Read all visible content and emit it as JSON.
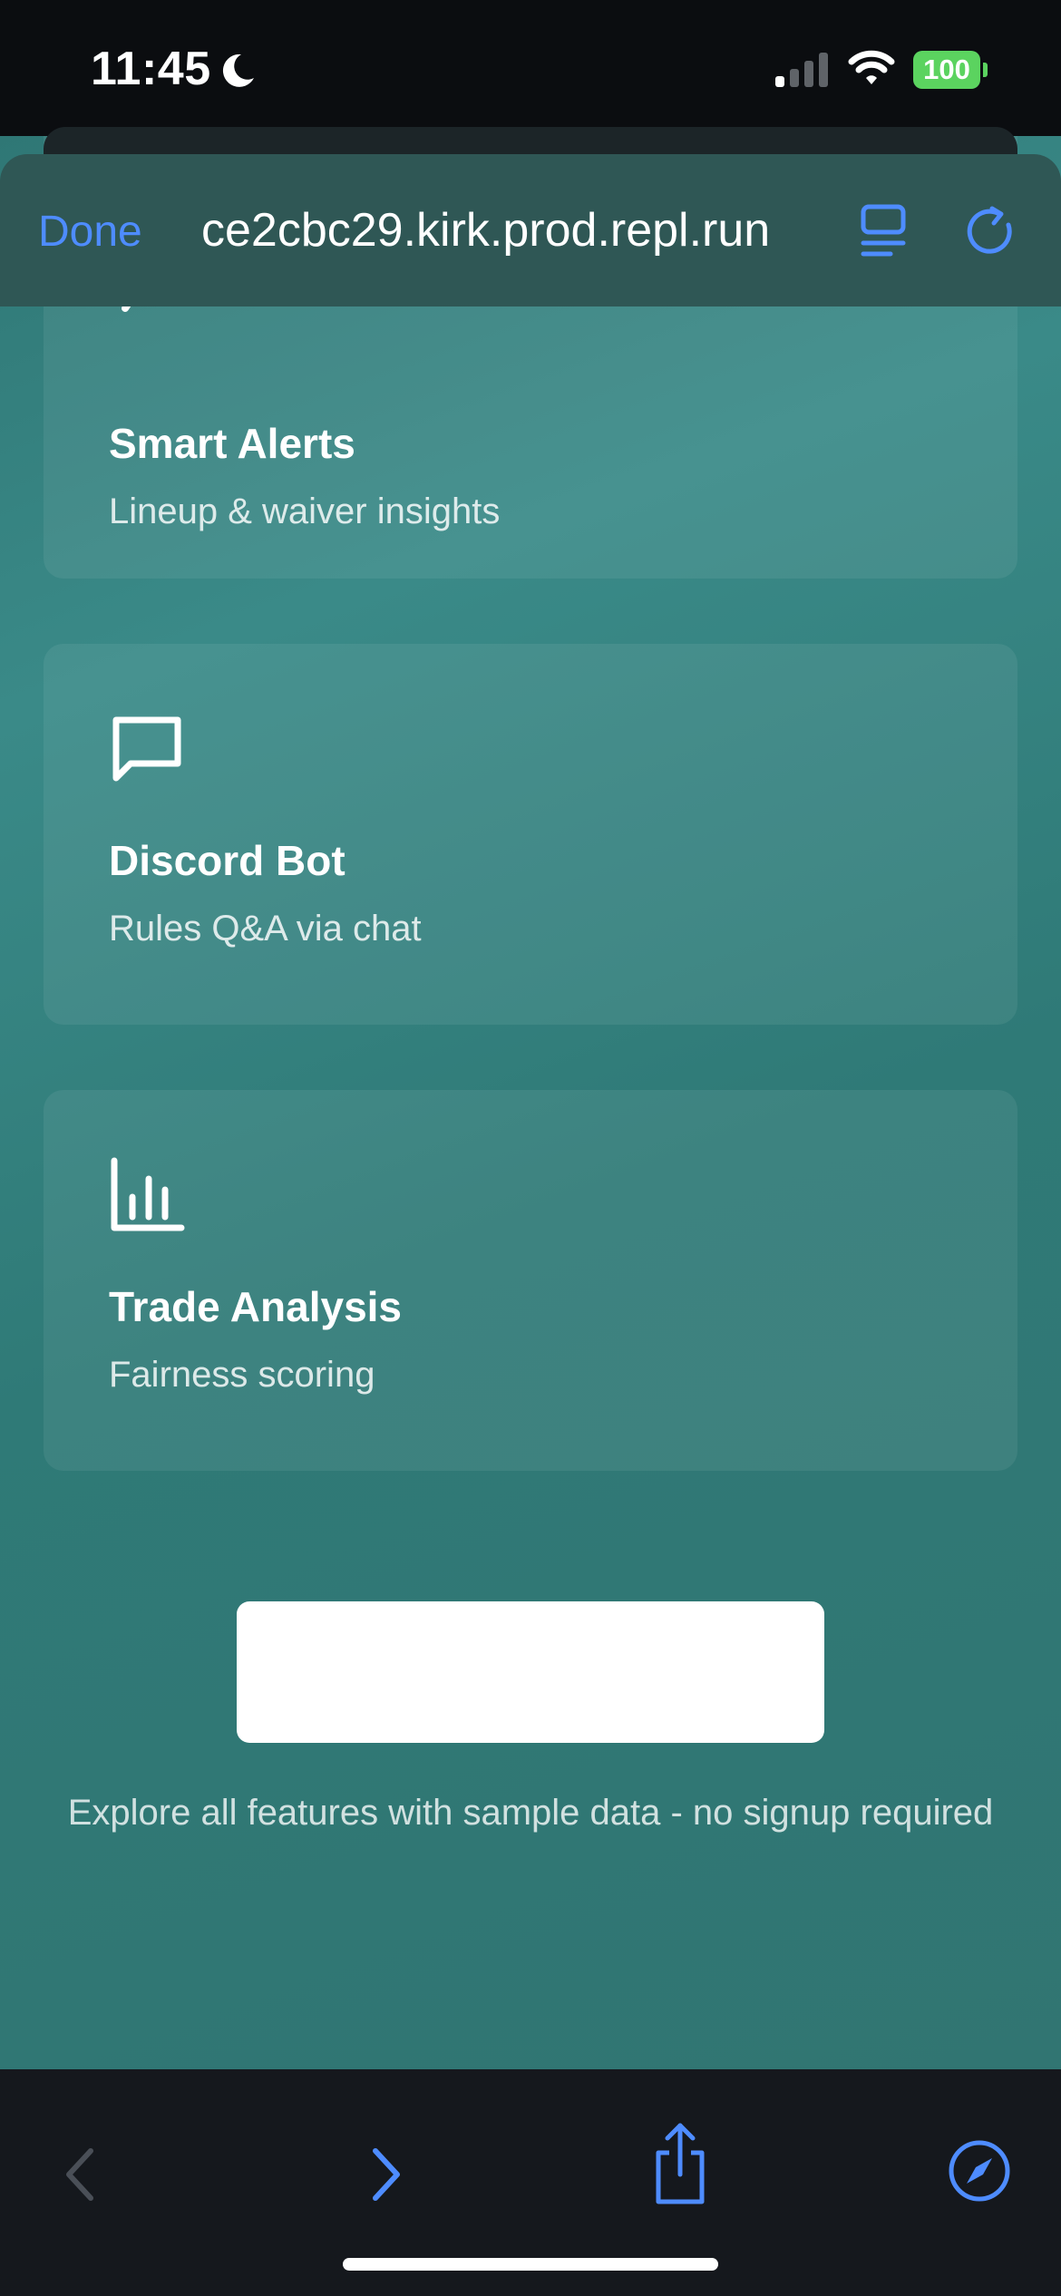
{
  "status_bar": {
    "time": "11:45",
    "battery_level": "100",
    "battery_color": "#5bd35f",
    "icons": [
      "moon-icon",
      "cellular-signal-icon",
      "wifi-icon",
      "battery-icon"
    ]
  },
  "browser": {
    "done_label": "Done",
    "url": "ce2cbc29.kirk.prod.repl.run",
    "accent_color": "#4e8cff",
    "icons": [
      "reader-mode-icon",
      "reload-icon"
    ]
  },
  "features": [
    {
      "icon": "megaphone-icon",
      "title": "Smart Alerts",
      "subtitle": "Lineup & waiver insights"
    },
    {
      "icon": "chat-bubble-icon",
      "title": "Discord Bot",
      "subtitle": "Rules Q&A via chat"
    },
    {
      "icon": "bar-chart-icon",
      "title": "Trade Analysis",
      "subtitle": "Fairness scoring"
    }
  ],
  "demo": {
    "button_label": "",
    "footnote": "Explore all features with sample data - no signup required"
  },
  "toolbar": {
    "icons": [
      "back-icon",
      "forward-icon",
      "share-icon",
      "compass-icon"
    ]
  }
}
